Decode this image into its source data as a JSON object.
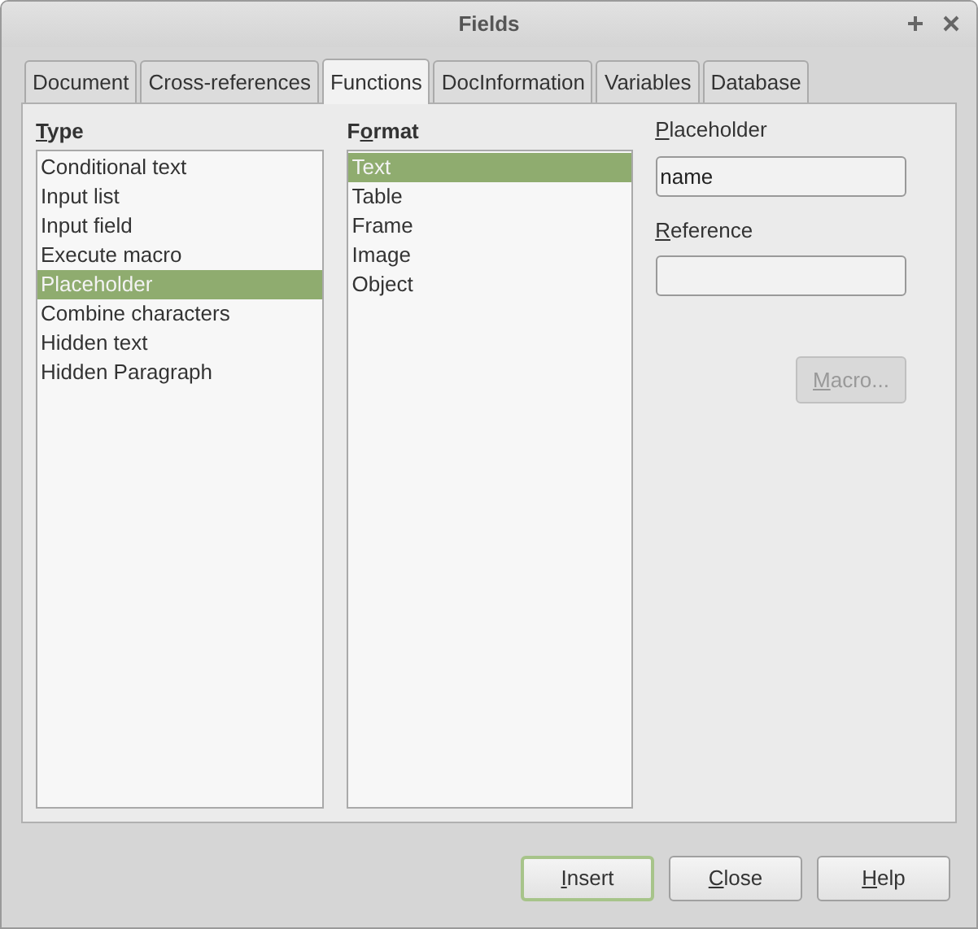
{
  "window": {
    "title": "Fields"
  },
  "tabs": [
    {
      "label": "Document",
      "selected": false
    },
    {
      "label": "Cross-references",
      "selected": false
    },
    {
      "label": "Functions",
      "selected": true
    },
    {
      "label": "DocInformation",
      "selected": false
    },
    {
      "label": "Variables",
      "selected": false
    },
    {
      "label": "Database",
      "selected": false
    }
  ],
  "type": {
    "heading": {
      "key": "T",
      "rest": "ype"
    },
    "items": [
      {
        "label": "Conditional text",
        "selected": false
      },
      {
        "label": "Input list",
        "selected": false
      },
      {
        "label": "Input field",
        "selected": false
      },
      {
        "label": "Execute macro",
        "selected": false
      },
      {
        "label": "Placeholder",
        "selected": true
      },
      {
        "label": "Combine characters",
        "selected": false
      },
      {
        "label": "Hidden text",
        "selected": false
      },
      {
        "label": "Hidden Paragraph",
        "selected": false
      }
    ]
  },
  "format": {
    "heading": {
      "pre": "F",
      "key": "o",
      "rest": "rmat"
    },
    "items": [
      {
        "label": "Text",
        "selected": true
      },
      {
        "label": "Table",
        "selected": false
      },
      {
        "label": "Frame",
        "selected": false
      },
      {
        "label": "Image",
        "selected": false
      },
      {
        "label": "Object",
        "selected": false
      }
    ]
  },
  "placeholder": {
    "label": {
      "key": "P",
      "rest": "laceholder"
    },
    "value": "name"
  },
  "reference": {
    "label": {
      "key": "R",
      "rest": "eference"
    }
  },
  "macro_button": {
    "label": {
      "key": "M",
      "rest": "acro..."
    },
    "disabled": true
  },
  "buttons": [
    {
      "label": {
        "key": "I",
        "rest": "nsert"
      },
      "default": true
    },
    {
      "label": {
        "key": "C",
        "rest": "lose"
      },
      "default": false
    },
    {
      "label": {
        "key": "H",
        "rest": "elp"
      },
      "default": false
    }
  ]
}
